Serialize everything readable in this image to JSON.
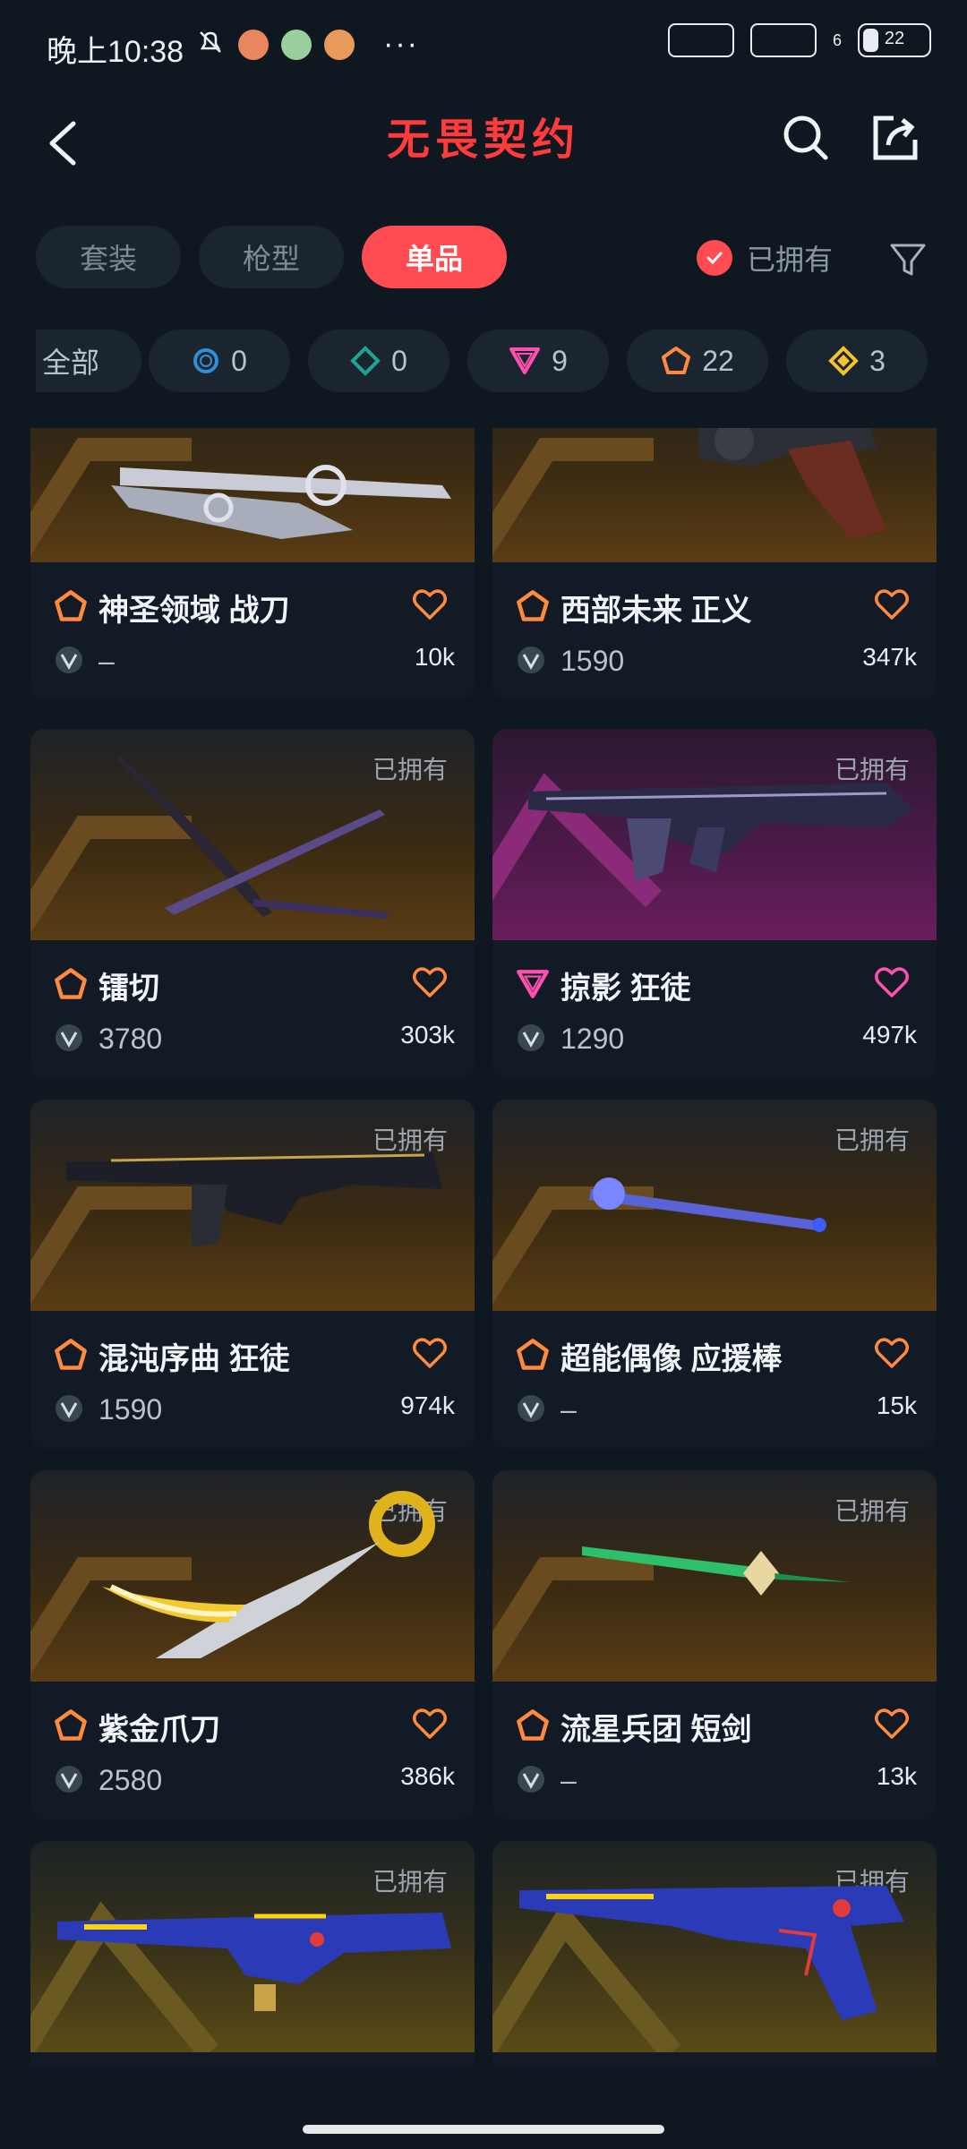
{
  "status": {
    "time": "晚上10:38",
    "battery": "22",
    "sim_index": "6"
  },
  "header": {
    "title": "无畏契约"
  },
  "tabs": [
    {
      "label": "套装",
      "active": false
    },
    {
      "label": "枪型",
      "active": false
    },
    {
      "label": "单品",
      "active": true
    }
  ],
  "owned_filter": {
    "label": "已拥有",
    "checked": true
  },
  "rarity_filters": [
    {
      "label": "全部",
      "type": "all"
    },
    {
      "count": "0",
      "type": "blue-circle"
    },
    {
      "count": "0",
      "type": "teal-diamond"
    },
    {
      "count": "9",
      "type": "pink-triangle"
    },
    {
      "count": "22",
      "type": "orange-pentagon"
    },
    {
      "count": "3",
      "type": "yellow-diamond"
    }
  ],
  "colors": {
    "accent_red": "#ff4b52",
    "title_red": "#ff3b3b",
    "exclusive_orange": "#ff8a3d",
    "ultra_pink": "#ff4fb0",
    "background": "#0f1720",
    "card": "#121b25"
  },
  "items": [
    {
      "name": "神圣领域 战刀",
      "price": "–",
      "likes": "10k",
      "owned_label": "",
      "rarity": "orange-pentagon",
      "bg": "gold",
      "art": "sword"
    },
    {
      "name": "西部未来 正义",
      "price": "1590",
      "likes": "347k",
      "owned_label": "",
      "rarity": "orange-pentagon",
      "bg": "gold",
      "art": "revolver"
    },
    {
      "name": "镭切",
      "price": "3780",
      "likes": "303k",
      "owned_label": "已拥有",
      "rarity": "orange-pentagon",
      "bg": "gold",
      "art": "katana"
    },
    {
      "name": "掠影 狂徒",
      "price": "1290",
      "likes": "497k",
      "owned_label": "已拥有",
      "rarity": "pink-triangle",
      "bg": "magenta",
      "art": "rifle"
    },
    {
      "name": "混沌序曲 狂徒",
      "price": "1590",
      "likes": "974k",
      "owned_label": "已拥有",
      "rarity": "orange-pentagon",
      "bg": "gold",
      "art": "rifle-dark"
    },
    {
      "name": "超能偶像 应援棒",
      "price": "–",
      "likes": "15k",
      "owned_label": "已拥有",
      "rarity": "orange-pentagon",
      "bg": "gold",
      "art": "wand"
    },
    {
      "name": "紫金爪刀",
      "price": "2580",
      "likes": "386k",
      "owned_label": "已拥有",
      "rarity": "orange-pentagon",
      "bg": "gold",
      "art": "karambit"
    },
    {
      "name": "流星兵团 短剑",
      "price": "–",
      "likes": "13k",
      "owned_label": "已拥有",
      "rarity": "orange-pentagon",
      "bg": "gold",
      "art": "dagger"
    },
    {
      "name": "",
      "price": "",
      "likes": "",
      "owned_label": "已拥有",
      "rarity": "yellow-diamond",
      "bg": "olive",
      "art": "blue-rifle"
    },
    {
      "name": "",
      "price": "",
      "likes": "",
      "owned_label": "已拥有",
      "rarity": "yellow-diamond",
      "bg": "olive",
      "art": "blue-pistol"
    }
  ]
}
